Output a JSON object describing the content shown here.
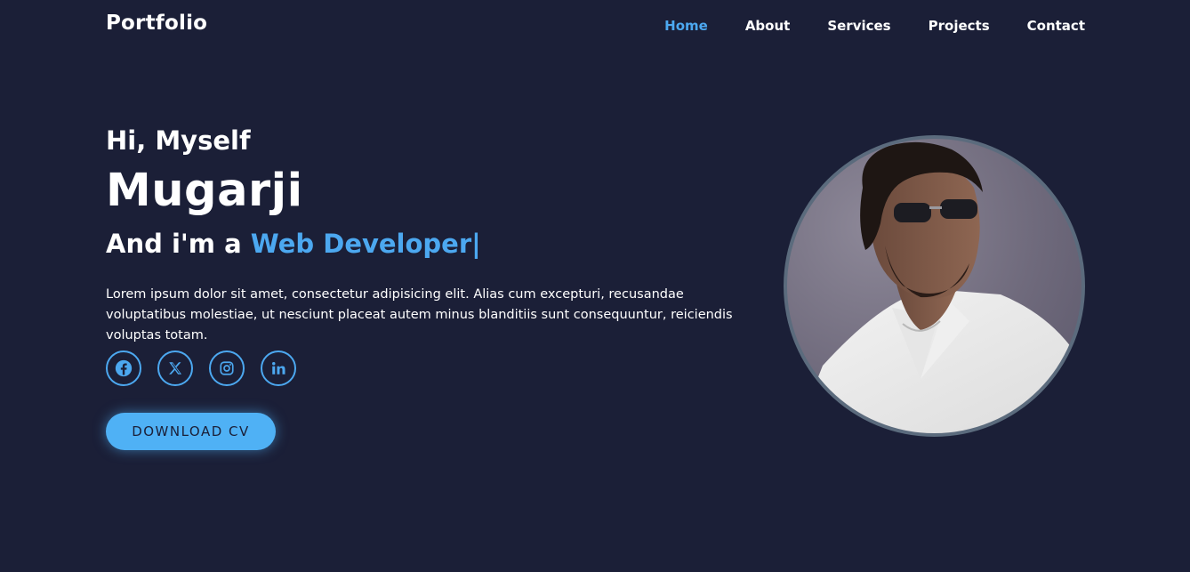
{
  "header": {
    "logo": "Portfolio",
    "nav": [
      {
        "label": "Home",
        "active": true
      },
      {
        "label": "About",
        "active": false
      },
      {
        "label": "Services",
        "active": false
      },
      {
        "label": "Projects",
        "active": false
      },
      {
        "label": "Contact",
        "active": false
      }
    ]
  },
  "hero": {
    "greeting": "Hi, Myself",
    "name": "Mugarji",
    "role_prefix": "And i'm a",
    "role": "Web Developer",
    "cursor": "|",
    "description": "Lorem ipsum dolor sit amet, consectetur adipisicing elit. Alias cum excepturi, recusandae voluptatibus molestiae, ut nesciunt placeat autem minus blanditiis sunt consequuntur, reiciendis voluptas totam.",
    "social": [
      {
        "icon": "facebook-icon"
      },
      {
        "icon": "x-twitter-icon"
      },
      {
        "icon": "instagram-icon"
      },
      {
        "icon": "linkedin-icon"
      }
    ],
    "download_label": "DOWNLOAD CV"
  },
  "colors": {
    "background": "#1b1f37",
    "accent": "#4ca8f0",
    "button": "#4fb1f5",
    "text": "#ffffff"
  }
}
